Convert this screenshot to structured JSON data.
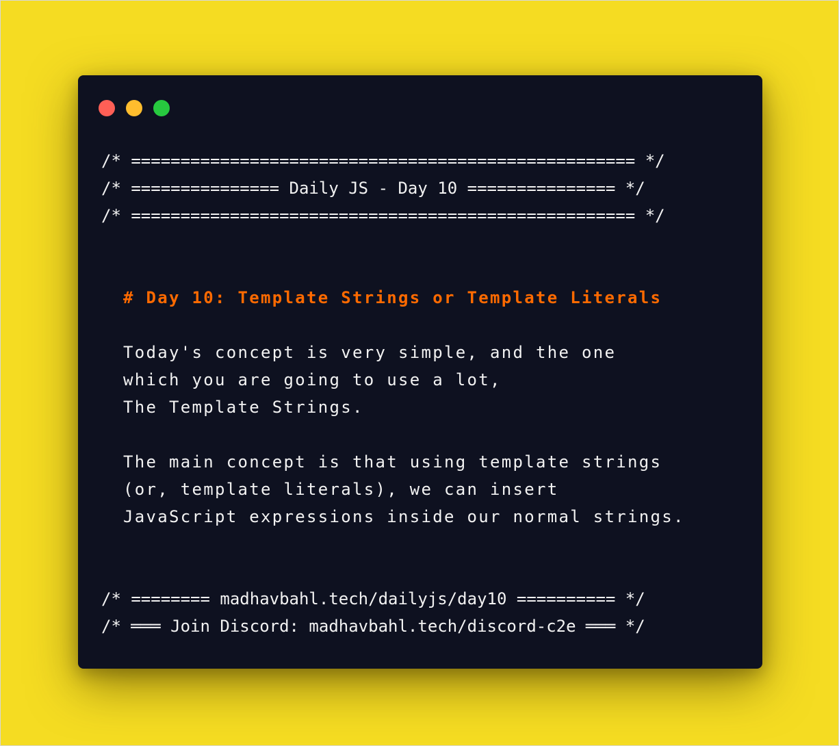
{
  "window_controls": [
    {
      "name": "close",
      "color": "#ff5f56"
    },
    {
      "name": "minimize",
      "color": "#ffbd2e"
    },
    {
      "name": "maximize",
      "color": "#27c93f"
    }
  ],
  "header": {
    "line1": "/* =================================================== */",
    "line2": "/* =============== Daily JS - Day 10 =============== */",
    "line3": "/* =================================================== */"
  },
  "content": {
    "heading": "# Day 10: Template Strings or Template Literals",
    "paragraph1": [
      "Today's concept is very simple, and the one",
      "which you are going to use a lot,",
      "The Template Strings."
    ],
    "paragraph2": [
      "The main concept is that using template strings",
      "(or, template literals), we can insert",
      "JavaScript expressions inside our normal strings."
    ]
  },
  "footer": {
    "line1": "/* ======== madhavbahl.tech/dailyjs/day10 ========== */",
    "line2": "/* ═══ Join Discord: madhavbahl.tech/discord-c2e ═══ */"
  },
  "colors": {
    "background": "#f5dc22",
    "window": "#0e1120",
    "text": "#f2f2f2",
    "heading": "#ff6a00"
  }
}
